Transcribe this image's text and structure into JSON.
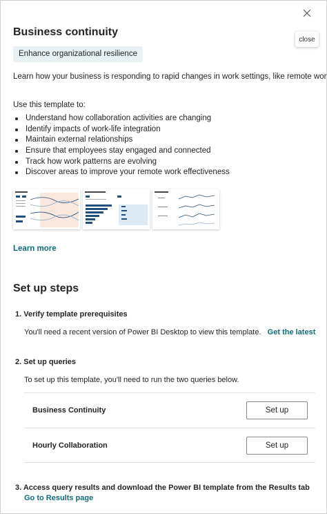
{
  "panel": {
    "close_tooltip": "close",
    "title": "Business continuity",
    "tag": "Enhance organizational resilience",
    "description": "Learn how your business is responding to rapid changes in work settings, like remote work.",
    "use_label": "Use this template to:",
    "bullets": [
      "Understand how collaboration activities are changing",
      "Identify impacts of work-life integration",
      "Maintain external relationships",
      "Ensure that employees stay engaged and connected",
      "Track how work patterns are evolving",
      "Discover areas to improve your remote work effectiveness"
    ],
    "learn_more": "Learn more"
  },
  "setup": {
    "title": "Set up steps",
    "step1": {
      "heading": "1. Verify template prerequisites",
      "text": "You'll need a recent version of Power BI Desktop to view this template.",
      "link": "Get the latest"
    },
    "step2": {
      "heading": "2. Set up queries",
      "text": "To set up this template, you'll need to run the two queries below.",
      "queries": [
        {
          "name": "Business Continuity",
          "button": "Set up"
        },
        {
          "name": "Hourly Collaboration",
          "button": "Set up"
        }
      ]
    },
    "step3": {
      "heading": "3. Access query results and download the Power BI template from the Results tab",
      "link": "Go to Results page"
    }
  },
  "colors": {
    "accent_link": "#0f6b7a",
    "tag_background": "#e8f2f4",
    "thumb_navy": "#1f4e79",
    "thumb_peach": "#f6d9c8"
  }
}
